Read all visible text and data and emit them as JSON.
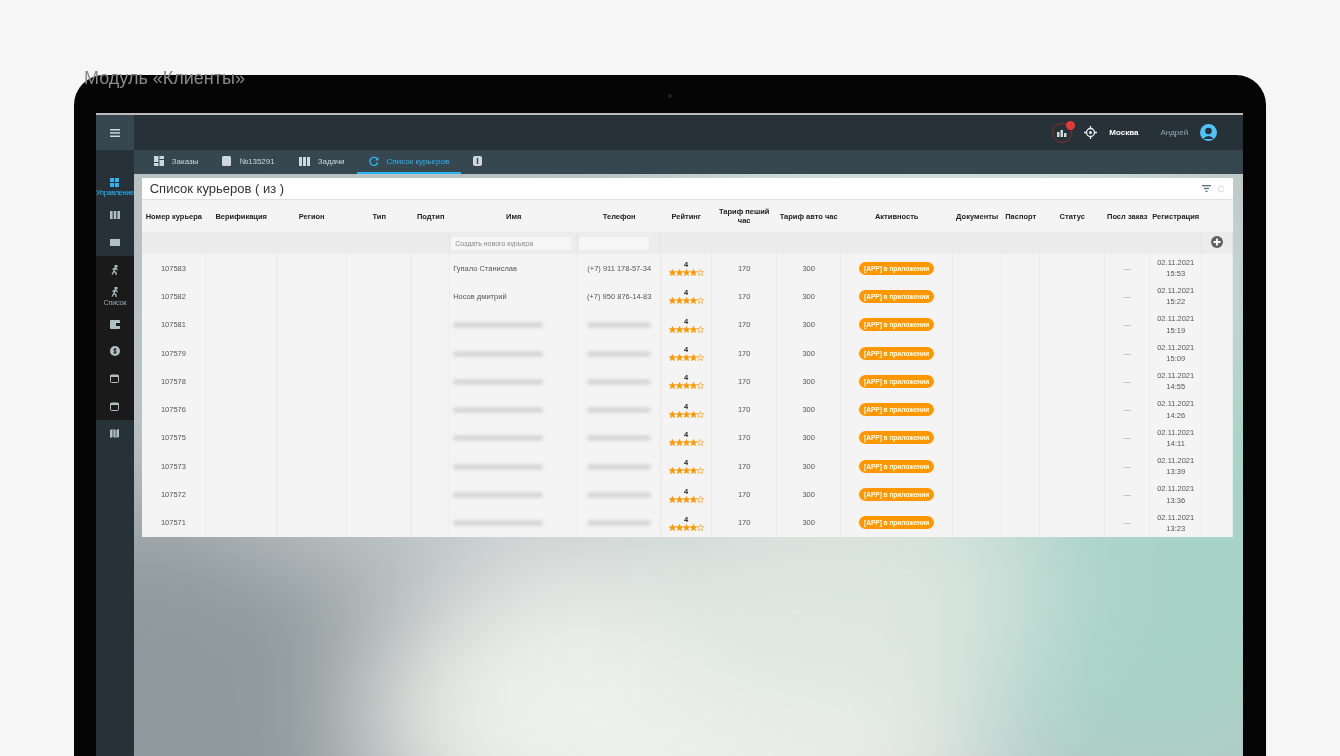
{
  "caption": "Модуль «Клиенты»",
  "sidebar": {
    "items": [
      {
        "label": "Управление",
        "selected": true,
        "kind": "main"
      },
      {
        "selected": false,
        "kind": "main"
      },
      {
        "selected": false,
        "kind": "main"
      },
      {
        "selected": false,
        "kind": "sub"
      },
      {
        "label": "Список",
        "selected": false,
        "kind": "sub"
      },
      {
        "selected": false,
        "kind": "sub"
      },
      {
        "selected": false,
        "kind": "sub"
      },
      {
        "selected": false,
        "kind": "sub"
      },
      {
        "selected": false,
        "kind": "sub"
      },
      {
        "selected": false,
        "kind": "main"
      }
    ]
  },
  "header": {
    "city": "Москва",
    "user": "Андрей",
    "notifications": true
  },
  "tabs": [
    {
      "label": "Заказы",
      "selected": false
    },
    {
      "label": "№135291",
      "selected": false
    },
    {
      "label": "Задачи",
      "selected": false
    },
    {
      "label": "Список курьеров",
      "selected": true
    },
    {
      "selected": false
    }
  ],
  "panel": {
    "title": "Список курьеров ( из )"
  },
  "table": {
    "columns": [
      "Номер курьера",
      "Верификация",
      "Регион",
      "Тип",
      "Подтип",
      "Имя",
      "Телефон",
      "Рейтинг",
      "Тариф пеший час",
      "Тариф авто час",
      "Активность",
      "Документы",
      "Паспорт",
      "Статус",
      "Посл заказ",
      "Регистрация"
    ],
    "new_courier": {
      "placeholder": "Создать нового курьера"
    },
    "rows": [
      {
        "number": "107583",
        "name": "Гупало Станислав",
        "phone": "(+7) 911 178-57-34",
        "redacted": false,
        "rating": "4",
        "stars": 4,
        "tariff_foot": "170",
        "tariff_auto": "300",
        "activity": "[APP] в приложении",
        "last_order": "—",
        "registered": "02.11.2021 15:53"
      },
      {
        "number": "107582",
        "name": "Носов дмитрий",
        "phone": "(+7) 950 876-14-83",
        "redacted": false,
        "rating": "4",
        "stars": 4,
        "tariff_foot": "170",
        "tariff_auto": "300",
        "activity": "[APP] в приложении",
        "last_order": "—",
        "registered": "02.11.2021 15:22"
      },
      {
        "number": "107581",
        "redacted": true,
        "rating": "4",
        "stars": 4,
        "tariff_foot": "170",
        "tariff_auto": "300",
        "activity": "[APP] в приложении",
        "last_order": "—",
        "registered": "02.11.2021 15:19"
      },
      {
        "number": "107579",
        "redacted": true,
        "rating": "4",
        "stars": 4,
        "tariff_foot": "170",
        "tariff_auto": "300",
        "activity": "[APP] в приложении",
        "last_order": "—",
        "registered": "02.11.2021 15:09"
      },
      {
        "number": "107578",
        "redacted": true,
        "rating": "4",
        "stars": 4,
        "tariff_foot": "170",
        "tariff_auto": "300",
        "activity": "[APP] в приложении",
        "last_order": "—",
        "registered": "02.11.2021 14:55"
      },
      {
        "number": "107576",
        "redacted": true,
        "rating": "4",
        "stars": 4,
        "tariff_foot": "170",
        "tariff_auto": "300",
        "activity": "[APP] в приложении",
        "last_order": "—",
        "registered": "02.11.2021 14:26"
      },
      {
        "number": "107575",
        "redacted": true,
        "rating": "4",
        "stars": 4,
        "tariff_foot": "170",
        "tariff_auto": "300",
        "activity": "[APP] в приложении",
        "last_order": "—",
        "registered": "02.11.2021 14:11"
      },
      {
        "number": "107573",
        "redacted": true,
        "rating": "4",
        "stars": 4,
        "tariff_foot": "170",
        "tariff_auto": "300",
        "activity": "[APP] в приложении",
        "last_order": "—",
        "registered": "02.11.2021 13:39"
      },
      {
        "number": "107572",
        "redacted": true,
        "rating": "4",
        "stars": 4,
        "tariff_foot": "170",
        "tariff_auto": "300",
        "activity": "[APP] в приложении",
        "last_order": "—",
        "registered": "02.11.2021 13:36"
      },
      {
        "number": "107571",
        "redacted": true,
        "rating": "4",
        "stars": 4,
        "tariff_foot": "170",
        "tariff_auto": "300",
        "activity": "[APP] в приложении",
        "last_order": "—",
        "registered": "02.11.2021 13:23"
      }
    ]
  }
}
